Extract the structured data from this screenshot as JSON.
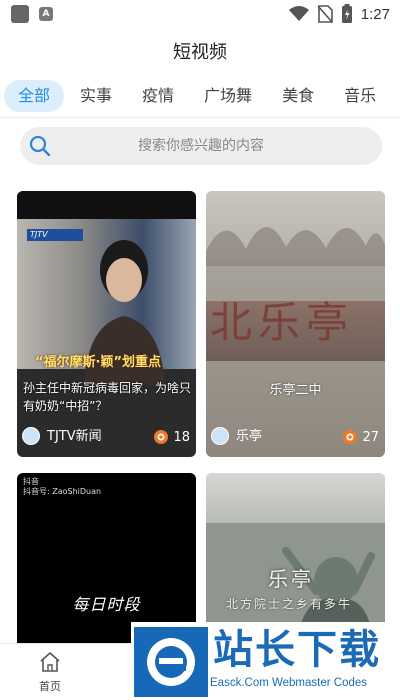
{
  "status_bar": {
    "time": "1:27",
    "app_icon_letter": "A"
  },
  "page": {
    "title": "短视频"
  },
  "tabs": [
    {
      "label": "全部",
      "active": true
    },
    {
      "label": "实事",
      "active": false
    },
    {
      "label": "疫情",
      "active": false
    },
    {
      "label": "广场舞",
      "active": false
    },
    {
      "label": "美食",
      "active": false
    },
    {
      "label": "音乐",
      "active": false
    }
  ],
  "search": {
    "placeholder": "搜索你感兴趣的内容"
  },
  "cards": [
    {
      "overlay_headline": "“福尔摩斯·颖”划重点",
      "caption": "孙主任中新冠病毒回家，为啥只有奶奶“中招”？",
      "author": "TJTV新闻",
      "views": "18"
    },
    {
      "overlay_text": "北乐亭",
      "caption": "乐亭二中",
      "author": "乐亭",
      "views": "27"
    },
    {
      "logo_text": "抖音",
      "logo_sub": "抖音号: ZaoShiDuan",
      "overlay_title": "每日时段"
    },
    {
      "overlay_title": "乐亭",
      "overlay_subtitle": "北方院士之乡有多牛"
    }
  ],
  "bottom_nav": {
    "home_label": "首页"
  },
  "watermark": {
    "brand_cn": "站长下载",
    "brand_en": "Easck.Com Webmaster Codes"
  },
  "colors": {
    "accent": "#1f8ee6",
    "tab_active_bg": "#dceefb",
    "views_icon": "#f07a2a"
  }
}
